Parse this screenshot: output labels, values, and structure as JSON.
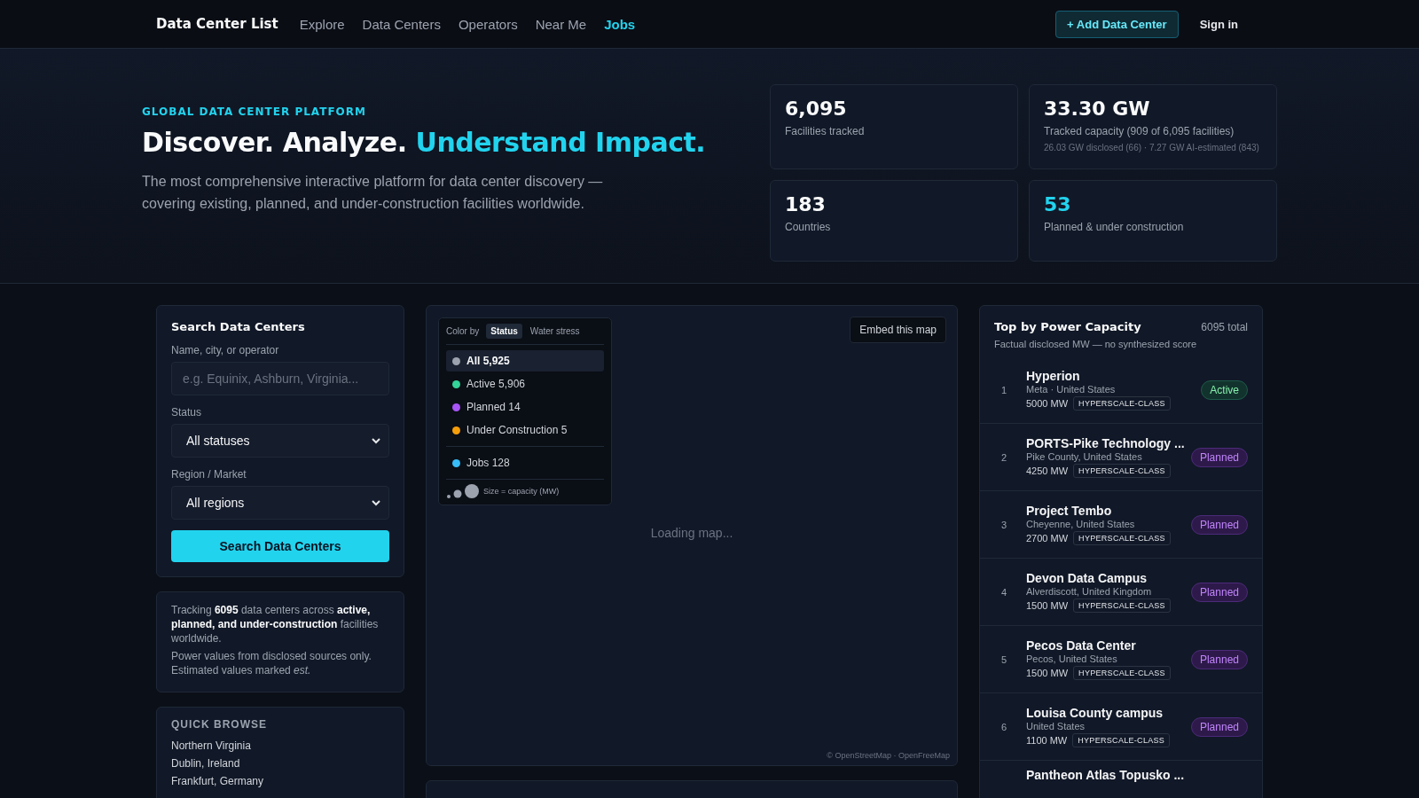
{
  "nav": {
    "brand": "Data Center List",
    "links": [
      {
        "label": "Explore",
        "selected": false
      },
      {
        "label": "Data Centers",
        "selected": false
      },
      {
        "label": "Operators",
        "selected": false
      },
      {
        "label": "Near Me",
        "selected": false
      },
      {
        "label": "Jobs",
        "selected": true
      }
    ],
    "add_button": "+ Add Data Center",
    "sign_in": "Sign in"
  },
  "hero": {
    "eyebrow": "GLOBAL DATA CENTER PLATFORM",
    "title": "Discover. Analyze.",
    "title_accent": "Understand Impact.",
    "description": "The most comprehensive interactive platform for data center discovery — covering existing, planned, and under-construction facilities worldwide.",
    "stats": [
      {
        "value": "6,095",
        "label": "Facilities tracked",
        "accent": false
      },
      {
        "value": "33.30 GW",
        "label": "Tracked capacity (909 of 6,095 facilities)",
        "note": "26.03 GW disclosed (66) · 7.27 GW AI-estimated (843)",
        "accent": false
      },
      {
        "value": "183",
        "label": "Countries",
        "accent": false
      },
      {
        "value": "53",
        "label": "Planned & under construction",
        "accent": true
      }
    ]
  },
  "search": {
    "title": "Search Data Centers",
    "name_label": "Name, city, or operator",
    "name_placeholder": "e.g. Equinix, Ashburn, Virginia...",
    "status_label": "Status",
    "status_value": "All statuses",
    "region_label": "Region / Market",
    "region_value": "All regions",
    "button": "Search Data Centers"
  },
  "info": {
    "summary": "Tracking **6095** data centers across **active, planned, and under-construction** facilities worldwide.",
    "note": "Power values from disclosed sources only. Estimated values marked *est.*"
  },
  "quick_browse": {
    "title": "QUICK BROWSE",
    "items": [
      "Northern Virginia",
      "Dublin, Ireland",
      "Frankfurt, Germany"
    ]
  },
  "map": {
    "color_by_label": "Color by",
    "color_by": [
      {
        "label": "Status",
        "selected": true
      },
      {
        "label": "Water stress",
        "selected": false
      }
    ],
    "legend": [
      {
        "label": "All 5,925",
        "color": "#9ca3af",
        "selected": true
      },
      {
        "label": "Active 5,906",
        "color": "#34d399",
        "selected": false
      },
      {
        "label": "Planned 14",
        "color": "#a855f7",
        "selected": false
      },
      {
        "label": "Under Construction 5",
        "color": "#f59e0b",
        "selected": false
      }
    ],
    "jobs": {
      "label": "Jobs 128",
      "color": "#38bdf8"
    },
    "size_label": "Size = capacity (MW)",
    "embed_button": "Embed this map",
    "loading": "Loading map...",
    "attribution": "© OpenStreetMap · OpenFreeMap"
  },
  "top": {
    "title": "Top by Power Capacity",
    "total": "6095 total",
    "subtitle": "Factual disclosed MW — no synthesized score",
    "rows": [
      {
        "rank": "1",
        "name": "Hyperion",
        "location": "Meta · United States",
        "power": "5000 MW",
        "tag": "HYPERSCALE-CLASS",
        "status": "Active",
        "kind": "active"
      },
      {
        "rank": "2",
        "name": "PORTS-Pike Technology ...",
        "location": "Pike County, United States",
        "power": "4250 MW",
        "tag": "HYPERSCALE-CLASS",
        "status": "Planned",
        "kind": "planned"
      },
      {
        "rank": "3",
        "name": "Project Tembo",
        "location": "Cheyenne, United States",
        "power": "2700 MW",
        "tag": "HYPERSCALE-CLASS",
        "status": "Planned",
        "kind": "planned"
      },
      {
        "rank": "4",
        "name": "Devon Data Campus",
        "location": "Alverdiscott, United Kingdom",
        "power": "1500 MW",
        "tag": "HYPERSCALE-CLASS",
        "status": "Planned",
        "kind": "planned"
      },
      {
        "rank": "5",
        "name": "Pecos Data Center",
        "location": "Pecos, United States",
        "power": "1500 MW",
        "tag": "HYPERSCALE-CLASS",
        "status": "Planned",
        "kind": "planned"
      },
      {
        "rank": "6",
        "name": "Louisa County campus",
        "location": "United States",
        "power": "1100 MW",
        "tag": "HYPERSCALE-CLASS",
        "status": "Planned",
        "kind": "planned"
      },
      {
        "name": "Pantheon Atlas Topusko ..."
      }
    ]
  }
}
